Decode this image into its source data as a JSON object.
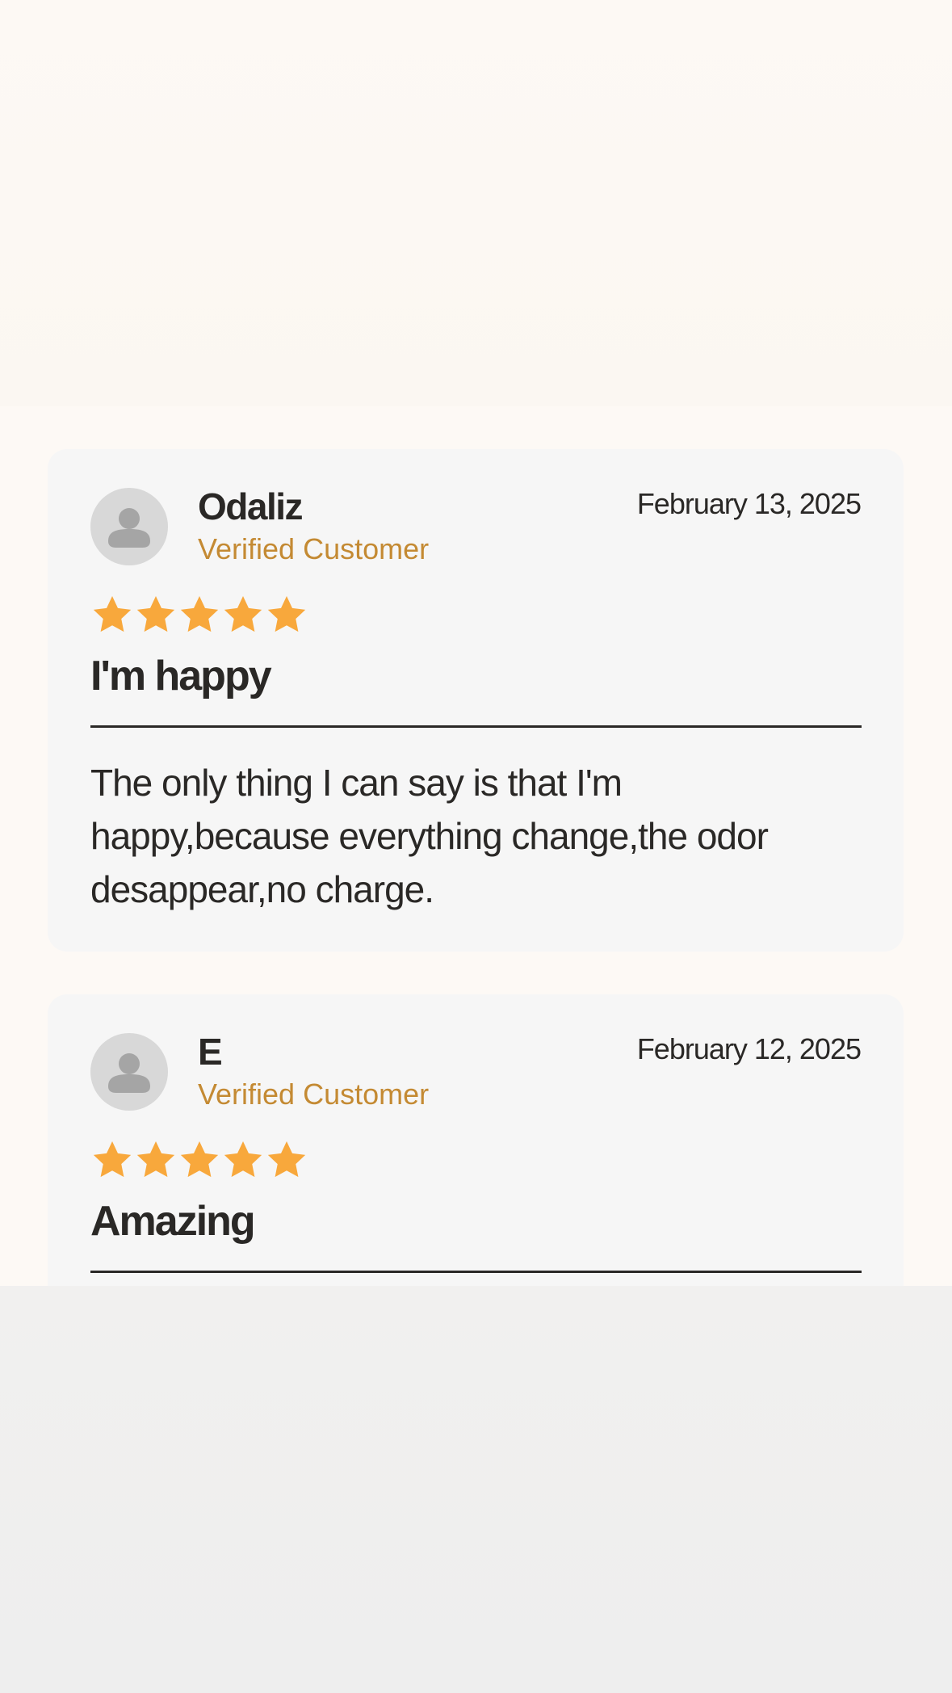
{
  "colors": {
    "star": "#f8a83c",
    "verified": "#c48a33",
    "text": "#2a2826",
    "card_bg": "#f6f6f6",
    "avatar_bg": "#d8d8d8",
    "avatar_figure": "#a5a5a5"
  },
  "reviews": [
    {
      "name": "Odaliz",
      "badge": "Verified Customer",
      "date": "February 13, 2025",
      "rating": 5,
      "title": "I'm happy",
      "body": "The only thing I can say is that I'm happy,because everything change,the odor desappear,no charge.",
      "avatar_icon": "user-avatar-icon"
    },
    {
      "name": "E",
      "badge": "Verified Customer",
      "date": "February 12, 2025",
      "rating": 5,
      "title": "Amazing",
      "avatar_icon": "user-avatar-icon"
    }
  ]
}
